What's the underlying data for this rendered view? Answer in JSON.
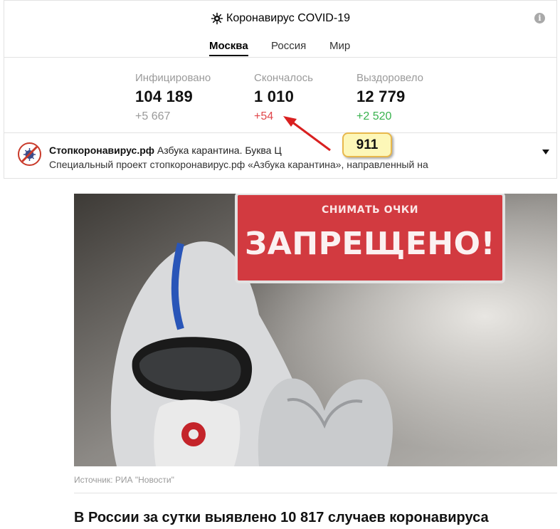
{
  "widget": {
    "title": "Коронавирус COVID-19",
    "title_icon": "virus-icon",
    "info_icon": "info-icon",
    "info_glyph": "i",
    "tabs": [
      {
        "label": "Москва",
        "active": true
      },
      {
        "label": "Россия",
        "active": false
      },
      {
        "label": "Мир",
        "active": false
      }
    ],
    "stats": [
      {
        "label": "Инфицировано",
        "value": "104 189",
        "delta": "+5 667",
        "delta_color": "#9a9a9a"
      },
      {
        "label": "Скончалось",
        "value": "1 010",
        "delta": "+54",
        "delta_color": "#e0464a"
      },
      {
        "label": "Выздоровело",
        "value": "12 779",
        "delta": "+2 520",
        "delta_color": "#38b24d"
      }
    ]
  },
  "news": {
    "logo_icon": "stopcoronavirus-logo-icon",
    "source": "Стопкоронавирус.рф",
    "title": " Азбука карантина. Буква Ц",
    "snippet": "Специальный проект стопкоронавирус.рф «Азбука карантина», направленный на",
    "expand_icon": "caret-down-icon"
  },
  "annotation": {
    "callout_text": "911"
  },
  "article": {
    "photo": {
      "sign_small": "СНИМАТЬ ОЧКИ",
      "sign_big": "ЗАПРЕЩЕНО!"
    },
    "caption": "Источник: РИА \"Новости\"",
    "headline": "В России за сутки выявлено 10 817 случаев коронавируса"
  }
}
